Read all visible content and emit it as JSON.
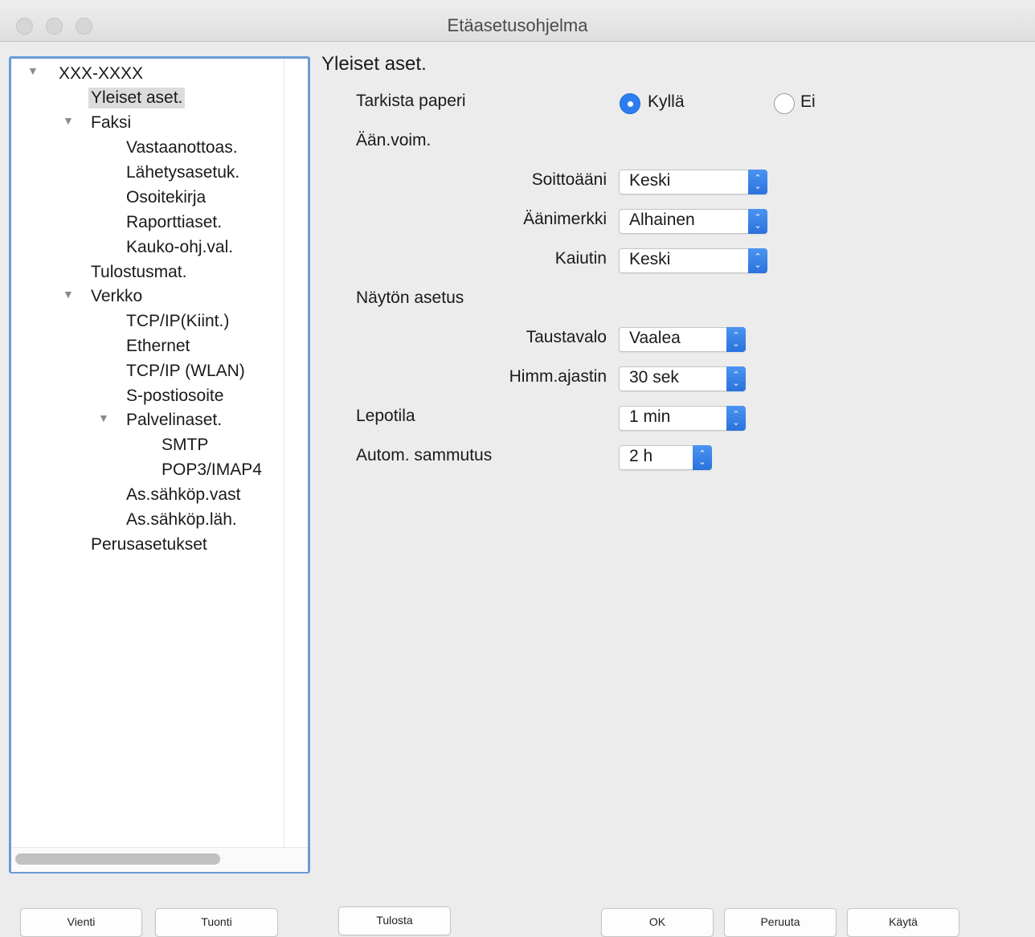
{
  "window": {
    "title": "Etäasetusohjelma"
  },
  "tree": {
    "root": "XXX-XXXX",
    "general": "Yleiset aset.",
    "fax": "Faksi",
    "fax_receive": "Vastaanottoas.",
    "fax_send": "Lähetysasetuk.",
    "address_book": "Osoitekirja",
    "report_settings": "Raporttiaset.",
    "remote_access": "Kauko-ohj.val.",
    "print_reports": "Tulostusmat.",
    "network": "Verkko",
    "tcpip_wired": "TCP/IP(Kiint.)",
    "ethernet": "Ethernet",
    "tcpip_wlan": "TCP/IP (WLAN)",
    "email_address": "S-postiosoite",
    "server_settings": "Palvelinaset.",
    "smtp": "SMTP",
    "pop3_imap4": "POP3/IMAP4",
    "email_receive": "As.sähköp.vast",
    "email_send": "As.sähköp.läh.",
    "initial_setup": "Perusasetukset"
  },
  "general": {
    "title": "Yleiset aset.",
    "check_paper": {
      "label": "Tarkista paperi",
      "option_yes": "Kyllä",
      "option_no": "Ei",
      "selected": "Kyllä"
    },
    "volume": {
      "heading": "Ään.voim.",
      "ring_label": "Soittoääni",
      "ring_value": "Keski",
      "beep_label": "Äänimerkki",
      "beep_value": "Alhainen",
      "speaker_label": "Kaiutin",
      "speaker_value": "Keski"
    },
    "display": {
      "heading": "Näytön asetus",
      "backlight_label": "Taustavalo",
      "backlight_value": "Vaalea",
      "dim_timer_label": "Himm.ajastin",
      "dim_timer_value": "30 sek"
    },
    "sleep": {
      "label": "Lepotila",
      "value": "1 min"
    },
    "auto_off": {
      "label": "Autom. sammutus",
      "value": "2 h"
    }
  },
  "buttons": {
    "export": "Vienti",
    "import": "Tuonti",
    "print": "Tulosta",
    "ok": "OK",
    "cancel": "Peruuta",
    "apply": "Käytä"
  }
}
